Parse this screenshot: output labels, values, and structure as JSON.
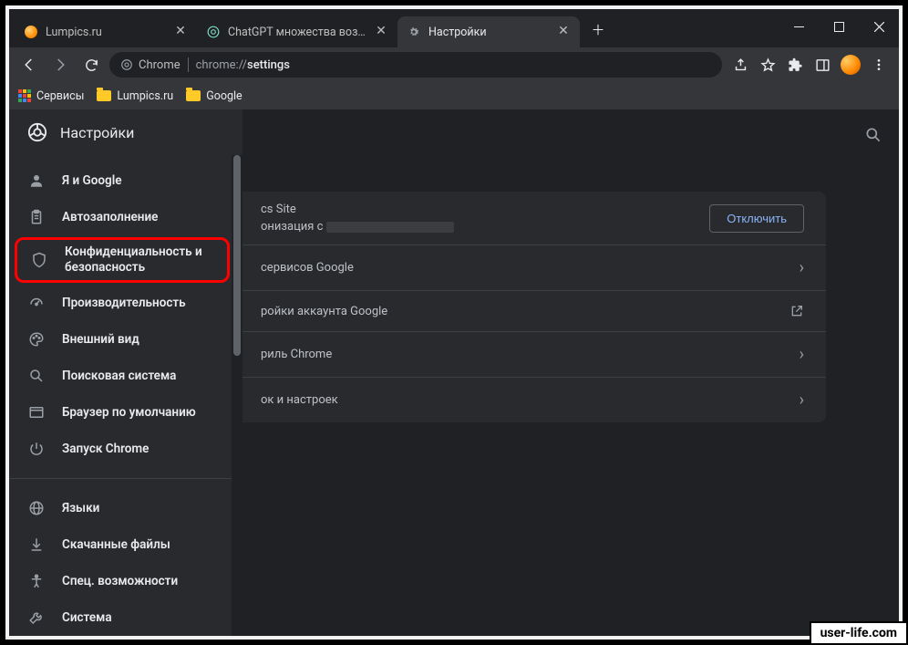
{
  "window": {
    "tabs": [
      {
        "title": "Lumpics.ru",
        "active": false,
        "favicon": "orange-dot"
      },
      {
        "title": "ChatGPT множества возможн",
        "active": false,
        "favicon": "chatgpt"
      },
      {
        "title": "Настройки",
        "active": true,
        "favicon": "gear"
      }
    ],
    "url_prefix": "Chrome",
    "url_scheme": "chrome://",
    "url_path": "settings"
  },
  "bookmarks": {
    "apps_label": "Сервисы",
    "items": [
      "Lumpics.ru",
      "Google"
    ]
  },
  "sidebar": {
    "title": "Настройки",
    "items": [
      {
        "label": "Я и Google",
        "icon": "person"
      },
      {
        "label": "Автозаполнение",
        "icon": "clipboard"
      },
      {
        "label": "Конфиденциальность и безопасность",
        "icon": "shield",
        "highlight": true
      },
      {
        "label": "Производительность",
        "icon": "speed"
      },
      {
        "label": "Внешний вид",
        "icon": "palette"
      },
      {
        "label": "Поисковая система",
        "icon": "search"
      },
      {
        "label": "Браузер по умолчанию",
        "icon": "window"
      },
      {
        "label": "Запуск Chrome",
        "icon": "power"
      }
    ],
    "items2": [
      {
        "label": "Языки",
        "icon": "globe"
      },
      {
        "label": "Скачанные файлы",
        "icon": "download"
      },
      {
        "label": "Спец. возможности",
        "icon": "accessibility"
      },
      {
        "label": "Система",
        "icon": "wrench"
      }
    ]
  },
  "main": {
    "card1_line1": "cs Site",
    "card1_line2_prefix": "онизация с",
    "card1_button": "Отключить",
    "rows": [
      {
        "text": "сервисов Google",
        "action": "chevron"
      },
      {
        "text": "ройки аккаунта Google",
        "action": "external"
      },
      {
        "text": "риль Chrome",
        "action": "chevron"
      },
      {
        "text": "ок и настроек",
        "action": "chevron"
      }
    ]
  },
  "watermark": "user-life.com"
}
